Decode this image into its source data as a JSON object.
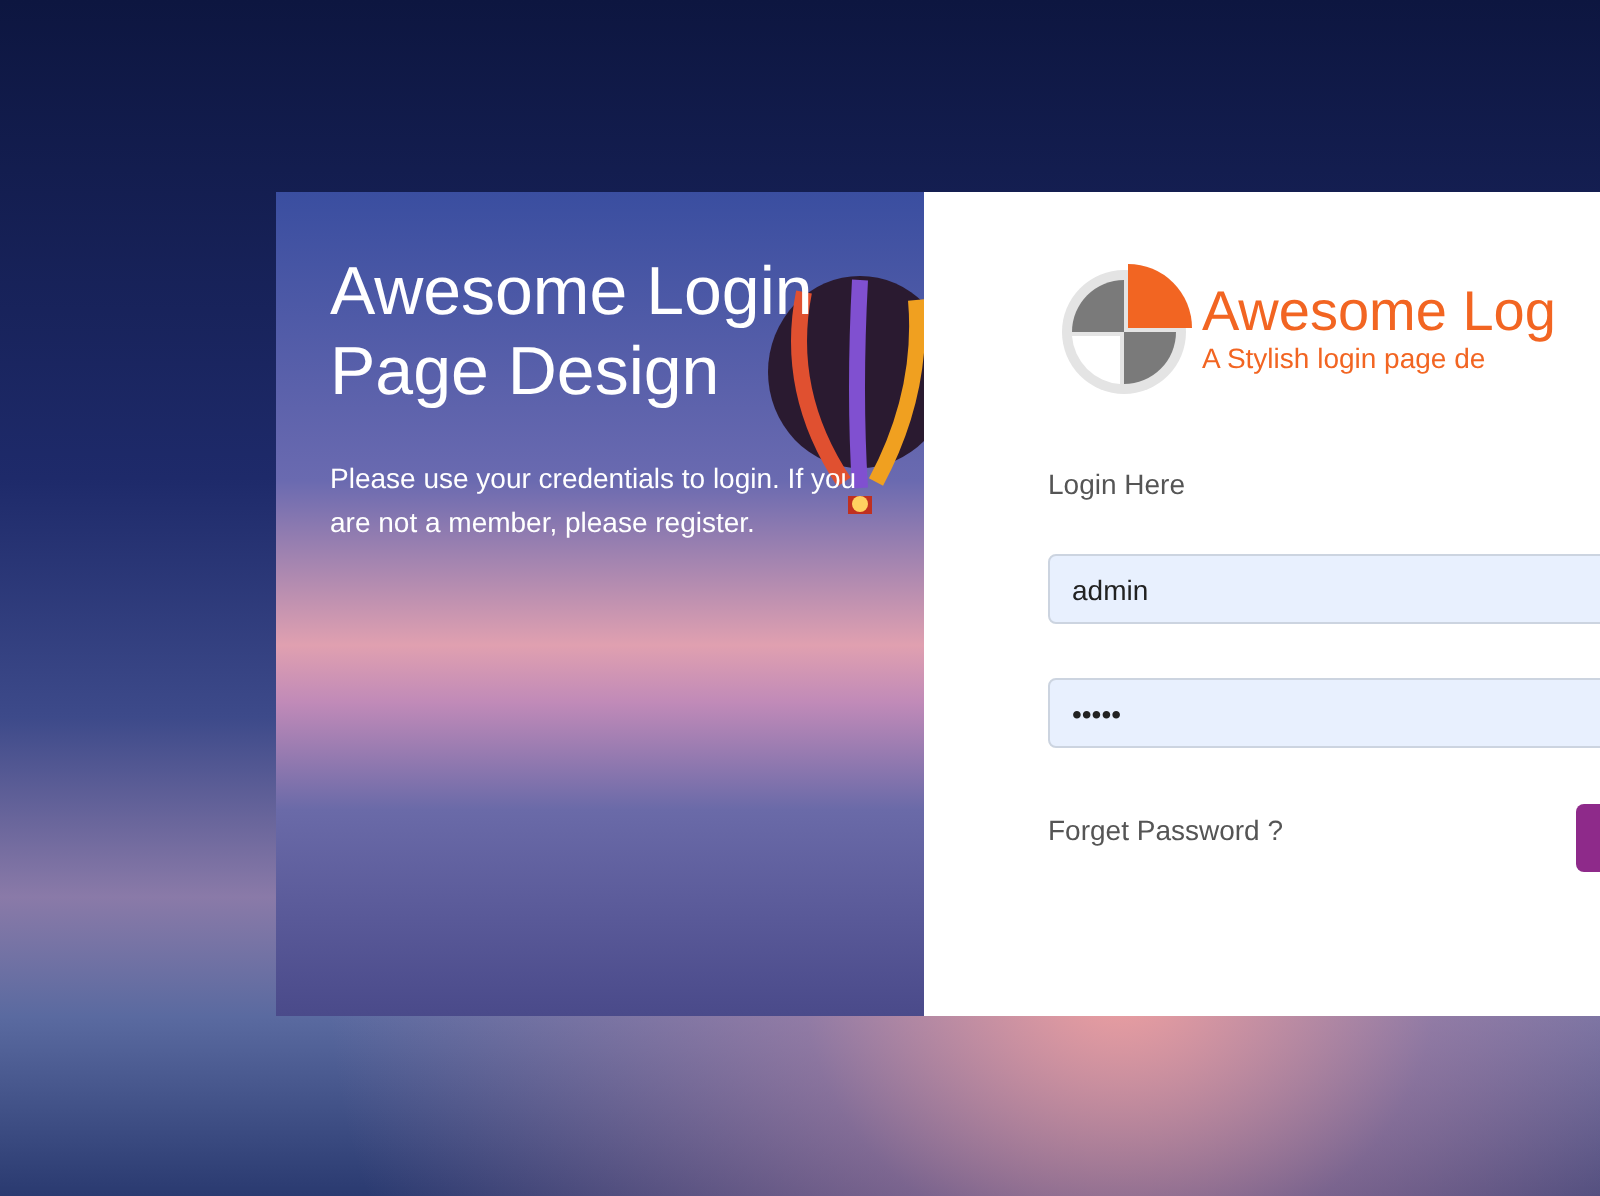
{
  "intro": {
    "title": "Awesome Login Page Design",
    "text": "Please use your credentials to login. If you are not a member, please register."
  },
  "logo": {
    "name": "Awesome Log",
    "tagline": "A Stylish login page de"
  },
  "form": {
    "heading": "Login Here",
    "username": {
      "value": "admin"
    },
    "password": {
      "value": "•••••"
    },
    "forgot_link": "Forget Password ?"
  }
}
